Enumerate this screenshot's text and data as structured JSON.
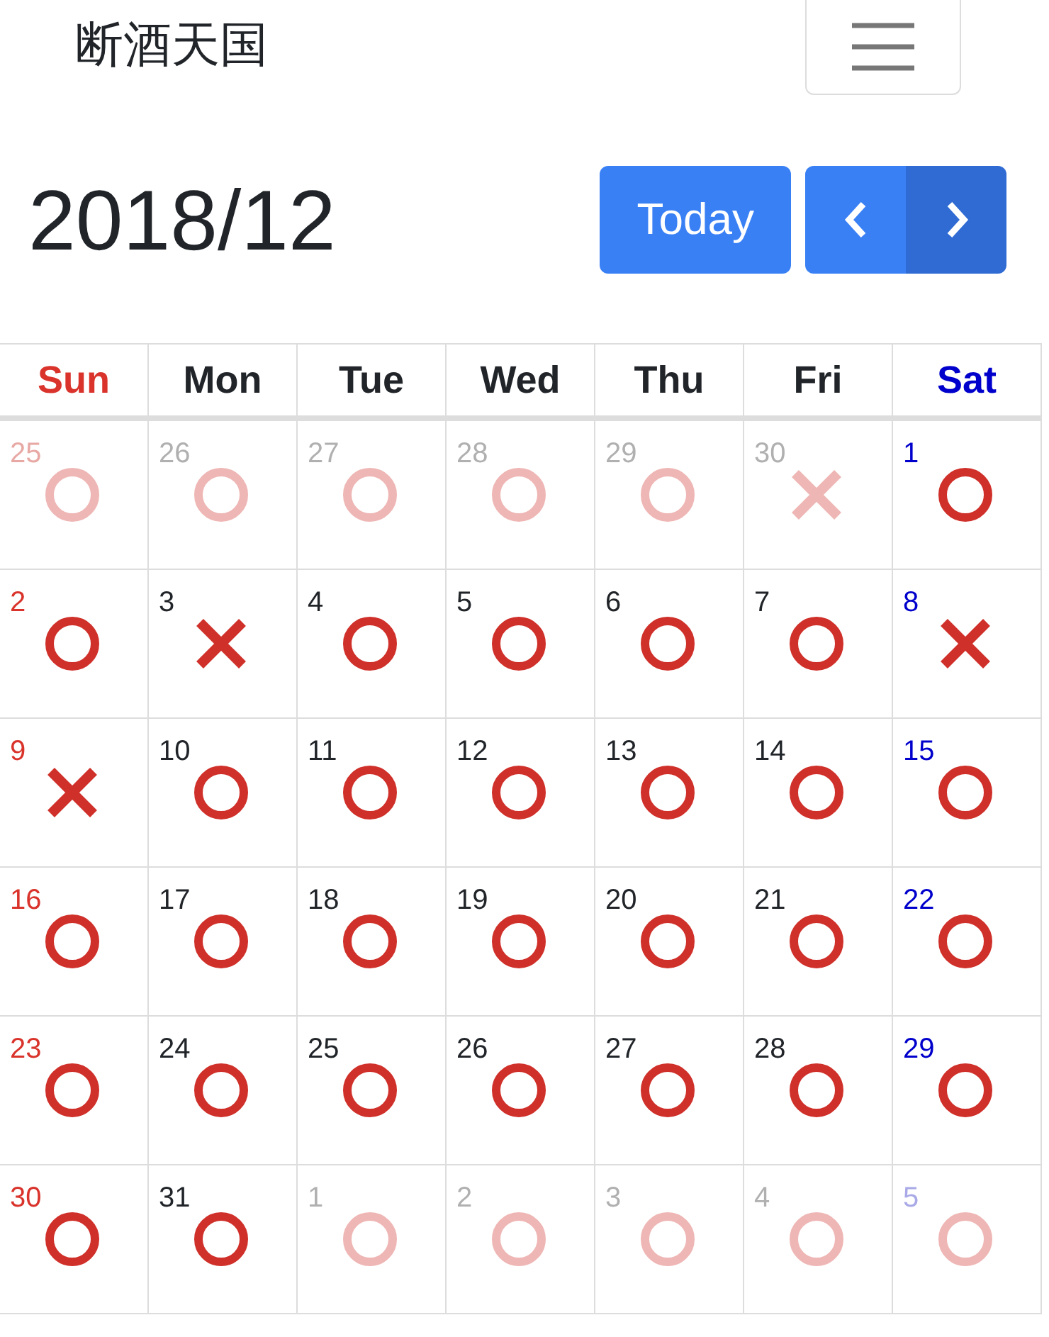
{
  "navbar": {
    "brand": "断酒天国"
  },
  "toolbar": {
    "title": "2018/12",
    "today_button": "Today"
  },
  "calendar": {
    "weekdays": [
      "Sun",
      "Mon",
      "Tue",
      "Wed",
      "Thu",
      "Fri",
      "Sat"
    ],
    "weeks": [
      [
        {
          "day": "25",
          "other_month": true,
          "sober": true
        },
        {
          "day": "26",
          "other_month": true,
          "sober": true
        },
        {
          "day": "27",
          "other_month": true,
          "sober": true
        },
        {
          "day": "28",
          "other_month": true,
          "sober": true
        },
        {
          "day": "29",
          "other_month": true,
          "sober": true
        },
        {
          "day": "30",
          "other_month": true,
          "sober": false
        },
        {
          "day": "1",
          "other_month": false,
          "sober": true
        }
      ],
      [
        {
          "day": "2",
          "other_month": false,
          "sober": true
        },
        {
          "day": "3",
          "other_month": false,
          "sober": false
        },
        {
          "day": "4",
          "other_month": false,
          "sober": true
        },
        {
          "day": "5",
          "other_month": false,
          "sober": true
        },
        {
          "day": "6",
          "other_month": false,
          "sober": true
        },
        {
          "day": "7",
          "other_month": false,
          "sober": true
        },
        {
          "day": "8",
          "other_month": false,
          "sober": false
        }
      ],
      [
        {
          "day": "9",
          "other_month": false,
          "sober": false
        },
        {
          "day": "10",
          "other_month": false,
          "sober": true
        },
        {
          "day": "11",
          "other_month": false,
          "sober": true
        },
        {
          "day": "12",
          "other_month": false,
          "sober": true
        },
        {
          "day": "13",
          "other_month": false,
          "sober": true
        },
        {
          "day": "14",
          "other_month": false,
          "sober": true
        },
        {
          "day": "15",
          "other_month": false,
          "sober": true
        }
      ],
      [
        {
          "day": "16",
          "other_month": false,
          "sober": true
        },
        {
          "day": "17",
          "other_month": false,
          "sober": true
        },
        {
          "day": "18",
          "other_month": false,
          "sober": true
        },
        {
          "day": "19",
          "other_month": false,
          "sober": true
        },
        {
          "day": "20",
          "other_month": false,
          "sober": true
        },
        {
          "day": "21",
          "other_month": false,
          "sober": true
        },
        {
          "day": "22",
          "other_month": false,
          "sober": true
        }
      ],
      [
        {
          "day": "23",
          "other_month": false,
          "sober": true
        },
        {
          "day": "24",
          "other_month": false,
          "sober": true
        },
        {
          "day": "25",
          "other_month": false,
          "sober": true
        },
        {
          "day": "26",
          "other_month": false,
          "sober": true
        },
        {
          "day": "27",
          "other_month": false,
          "sober": true
        },
        {
          "day": "28",
          "other_month": false,
          "sober": true
        },
        {
          "day": "29",
          "other_month": false,
          "sober": true
        }
      ],
      [
        {
          "day": "30",
          "other_month": false,
          "sober": true
        },
        {
          "day": "31",
          "other_month": false,
          "sober": true
        },
        {
          "day": "1",
          "other_month": true,
          "sober": true
        },
        {
          "day": "2",
          "other_month": true,
          "sober": true
        },
        {
          "day": "3",
          "other_month": true,
          "sober": true
        },
        {
          "day": "4",
          "other_month": true,
          "sober": true
        },
        {
          "day": "5",
          "other_month": true,
          "sober": true
        }
      ]
    ]
  }
}
